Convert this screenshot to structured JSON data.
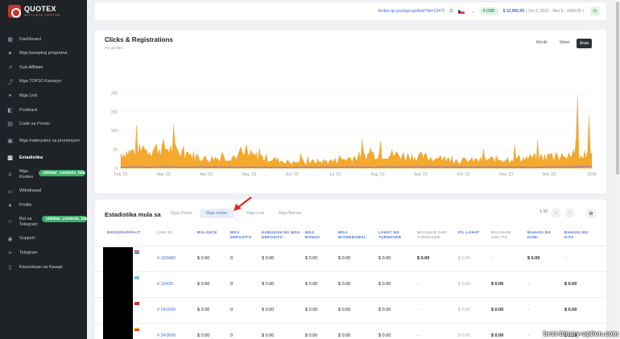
{
  "brand": {
    "title": "QUOTEX",
    "subtitle": "AFFILIATE CENTER"
  },
  "sidebar": {
    "items": [
      {
        "label": "Dashboard",
        "icon": "grid-icon"
      },
      {
        "label": "Mga kasaping programa",
        "icon": "send-icon"
      },
      {
        "label": "Sub-Affiliate",
        "icon": "arrow-icon"
      },
      {
        "label": "Mga TOP10 Kasosyo",
        "icon": "trend-icon"
      },
      {
        "label": "Mga Link",
        "icon": "link-icon"
      },
      {
        "label": "Postback",
        "icon": "postback-icon"
      },
      {
        "label": "Code sa Promo",
        "icon": "code-icon"
      },
      {
        "label": "Mga materyales sa promosyon",
        "icon": "image-icon"
      },
      {
        "label": "Estadistika",
        "icon": "stats-icon"
      },
      {
        "label": "Mga Kontes",
        "icon": "trophy-icon"
      },
      {
        "label": "Withdrawal",
        "icon": "wallet-icon"
      },
      {
        "label": "Profile",
        "icon": "user-icon"
      },
      {
        "label": "Bot sa Telegram",
        "icon": "bot-icon"
      },
      {
        "label": "Support",
        "icon": "support-icon"
      },
      {
        "label": "Telegram",
        "icon": "telegram-icon"
      },
      {
        "label": "Kasunduan sa Kasapi",
        "icon": "doc-icon"
      }
    ],
    "pills": [
      "sidebar_contests_label",
      "sidebar_contests_lab"
    ]
  },
  "topbar": {
    "link": "broker-qx.pro/sign-up/fast/?lid=13472",
    "badge": "0 USD",
    "balance": "$ 12,990.09",
    "balance_sub": "( Oct 1, 2021 - Nov 6 - 2006.05 )"
  },
  "chart": {
    "title": "Clicks & Registrations",
    "subtitle": "For all links",
    "periods": [
      "Month",
      "Week",
      "Araw"
    ],
    "y_ticks": [
      "200",
      "150",
      "100",
      "50",
      "0"
    ],
    "x_ticks": [
      "Feb '23",
      "Mar '23",
      "Apr '23",
      "May '23",
      "Jun '23",
      "Jul '23",
      "Aug '23",
      "Sep '23",
      "Oct '23",
      "Nov '23",
      "Dec '23",
      "2024"
    ]
  },
  "chart_data": {
    "type": "area",
    "ylim": [
      0,
      250
    ],
    "series_colors": {
      "clicks": "#f4a82c",
      "registrations": "#7b68ee"
    },
    "x": [
      "Feb '23",
      "Mar '23",
      "Apr '23",
      "May '23",
      "Jun '23",
      "Jul '23",
      "Aug '23",
      "Sep '23",
      "Oct '23",
      "Nov '23",
      "Dec '23",
      "2024"
    ],
    "series": [
      {
        "values": [
          40,
          55,
          25,
          35,
          15,
          20,
          40,
          30,
          20,
          25,
          30,
          195
        ]
      },
      {
        "values": [
          2,
          3,
          2,
          2,
          1,
          2,
          2,
          3,
          2,
          2,
          2,
          4
        ]
      }
    ]
  },
  "stats": {
    "title": "Estadistika mula sa",
    "tabs": [
      "Mga Petsa",
      "Mga trader",
      "Mga Link",
      "Mga Bansa"
    ],
    "pager": "1-15",
    "headers": [
      "NAGKIPAGPALIT",
      "LINK ID",
      "BALANCE",
      "MGA DEPOSITO",
      "KABUUAN NG MGA DEPOSITO",
      "MGA BONUS",
      "MGA WITHDRAWAL",
      "LAHAT NG TURNOVER",
      "MALINAW AND TURNOVER",
      "P/L LAHAT",
      "MALINAW ANG P/L",
      "BAHAGI NG DAMI",
      "BAHAGI NG KITA"
    ],
    "rows": [
      {
        "link": "# 193480",
        "balance": "$ 0.00",
        "deposits": "0",
        "dep_total": "$ 0.00",
        "bonus": "$ 0.00",
        "withdraw": "$ 0.00",
        "turnover": "$ 0.00",
        "clear_turnover": "$ 0.00",
        "pl": "$ 0.00",
        "clear_pl": "–",
        "share_vol": "$ 0.00",
        "share_rev": "–"
      },
      {
        "link": "# 13435",
        "balance": "$ 0.00",
        "deposits": "0",
        "dep_total": "$ 0.00",
        "bonus": "$ 0.00",
        "withdraw": "$ 0.00",
        "turnover": "$ 0.00",
        "clear_turnover": "–",
        "pl": "$ 0.00",
        "clear_pl": "$ 0.00",
        "share_vol": "–",
        "share_rev": "$ 0.00"
      },
      {
        "link": "# 241600",
        "balance": "$ 0.00",
        "deposits": "0",
        "dep_total": "$ 0.00",
        "bonus": "$ 0.00",
        "withdraw": "$ 0.00",
        "turnover": "$ 0.00",
        "clear_turnover": "–",
        "pl": "$ 0.00",
        "clear_pl": "$ 0.00",
        "share_vol": "–",
        "share_rev": "$ 0.00"
      },
      {
        "link": "# 241600",
        "balance": "$ 0.00",
        "deposits": "0",
        "dep_total": "$ 0.00",
        "bonus": "$ 0.00",
        "withdraw": "$ 0.00",
        "turnover": "$ 0.00",
        "clear_turnover": "–",
        "pl": "$ 0.00",
        "clear_pl": "$ 0.00",
        "share_vol": "–",
        "share_rev": "$ 0.00"
      }
    ]
  },
  "watermark": "best-binary-option.com"
}
